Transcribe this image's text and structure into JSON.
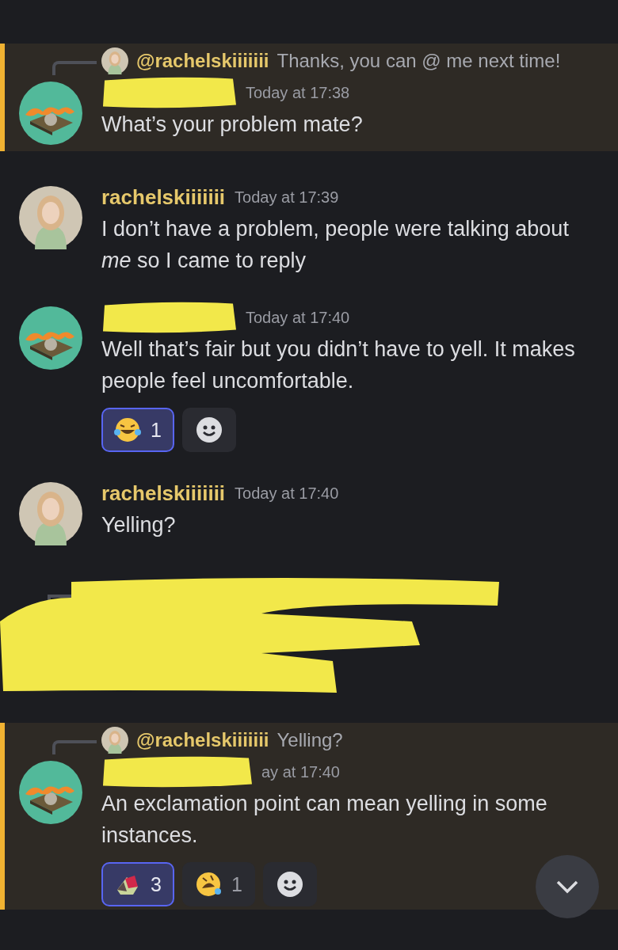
{
  "messages": [
    {
      "kind": "message",
      "mentioned": true,
      "redacted_author": true,
      "reply": {
        "author": "@rachelskiiiiiii",
        "text": "Thanks, you can @ me next time!"
      },
      "timestamp": "Today at 17:38",
      "text": "What’s your problem mate?"
    },
    {
      "kind": "message",
      "mentioned": false,
      "redacted_author": false,
      "author": "rachelskiiiiiii",
      "timestamp": "Today at 17:39",
      "text": "I don’t have a problem, people were talking about *me* so I came to reply"
    },
    {
      "kind": "message",
      "mentioned": false,
      "redacted_author": true,
      "timestamp": "Today at 17:40",
      "text": "Well that’s fair but you didn’t have to yell. It makes people feel uncomfortable.",
      "reactions": [
        {
          "kind": "joy",
          "count": "1",
          "selected": true
        }
      ]
    },
    {
      "kind": "message",
      "mentioned": false,
      "redacted_author": false,
      "author": "rachelskiiiiiii",
      "timestamp": "Today at 17:40",
      "text": "Yelling?"
    },
    {
      "kind": "redacted"
    },
    {
      "kind": "message",
      "mentioned": true,
      "redacted_author": true,
      "reply": {
        "author": "@rachelskiiiiiii",
        "text": "Yelling?"
      },
      "timestamp": "ay at 17:40",
      "text": "An exclamation point can mean yelling in some instances.",
      "reactions": [
        {
          "kind": "custom",
          "count": "3",
          "selected": true
        },
        {
          "kind": "rofl",
          "count": "1",
          "selected": false
        }
      ]
    }
  ]
}
